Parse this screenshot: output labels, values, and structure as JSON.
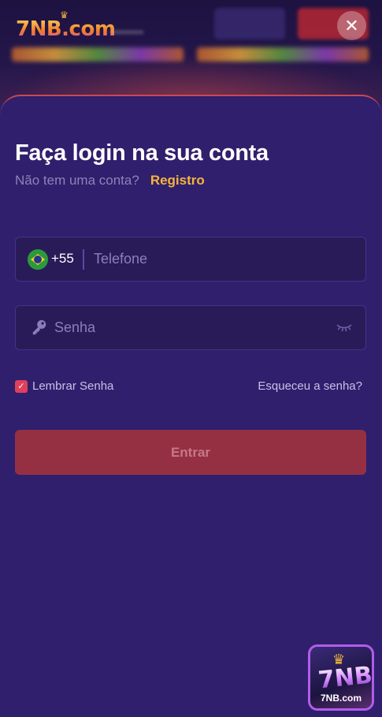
{
  "header": {
    "logo_text": "7NB.com",
    "close_symbol": "✕"
  },
  "login": {
    "title": "Faça login na sua conta",
    "no_account_text": "Não tem uma conta?",
    "register_label": "Registro",
    "country_code": "+55",
    "phone_placeholder": "Telefone",
    "password_placeholder": "Senha",
    "remember_label": "Lembrar Senha",
    "remember_checked": true,
    "forgot_label": "Esqueceu a senha?",
    "submit_label": "Entrar"
  },
  "app_badge": {
    "big_text": "7NB",
    "label": "7NB.com"
  },
  "colors": {
    "background": "#301f6d",
    "accent_gold": "#f4b43c",
    "submit_bg": "#953042",
    "checkbox": "#e0405c"
  }
}
